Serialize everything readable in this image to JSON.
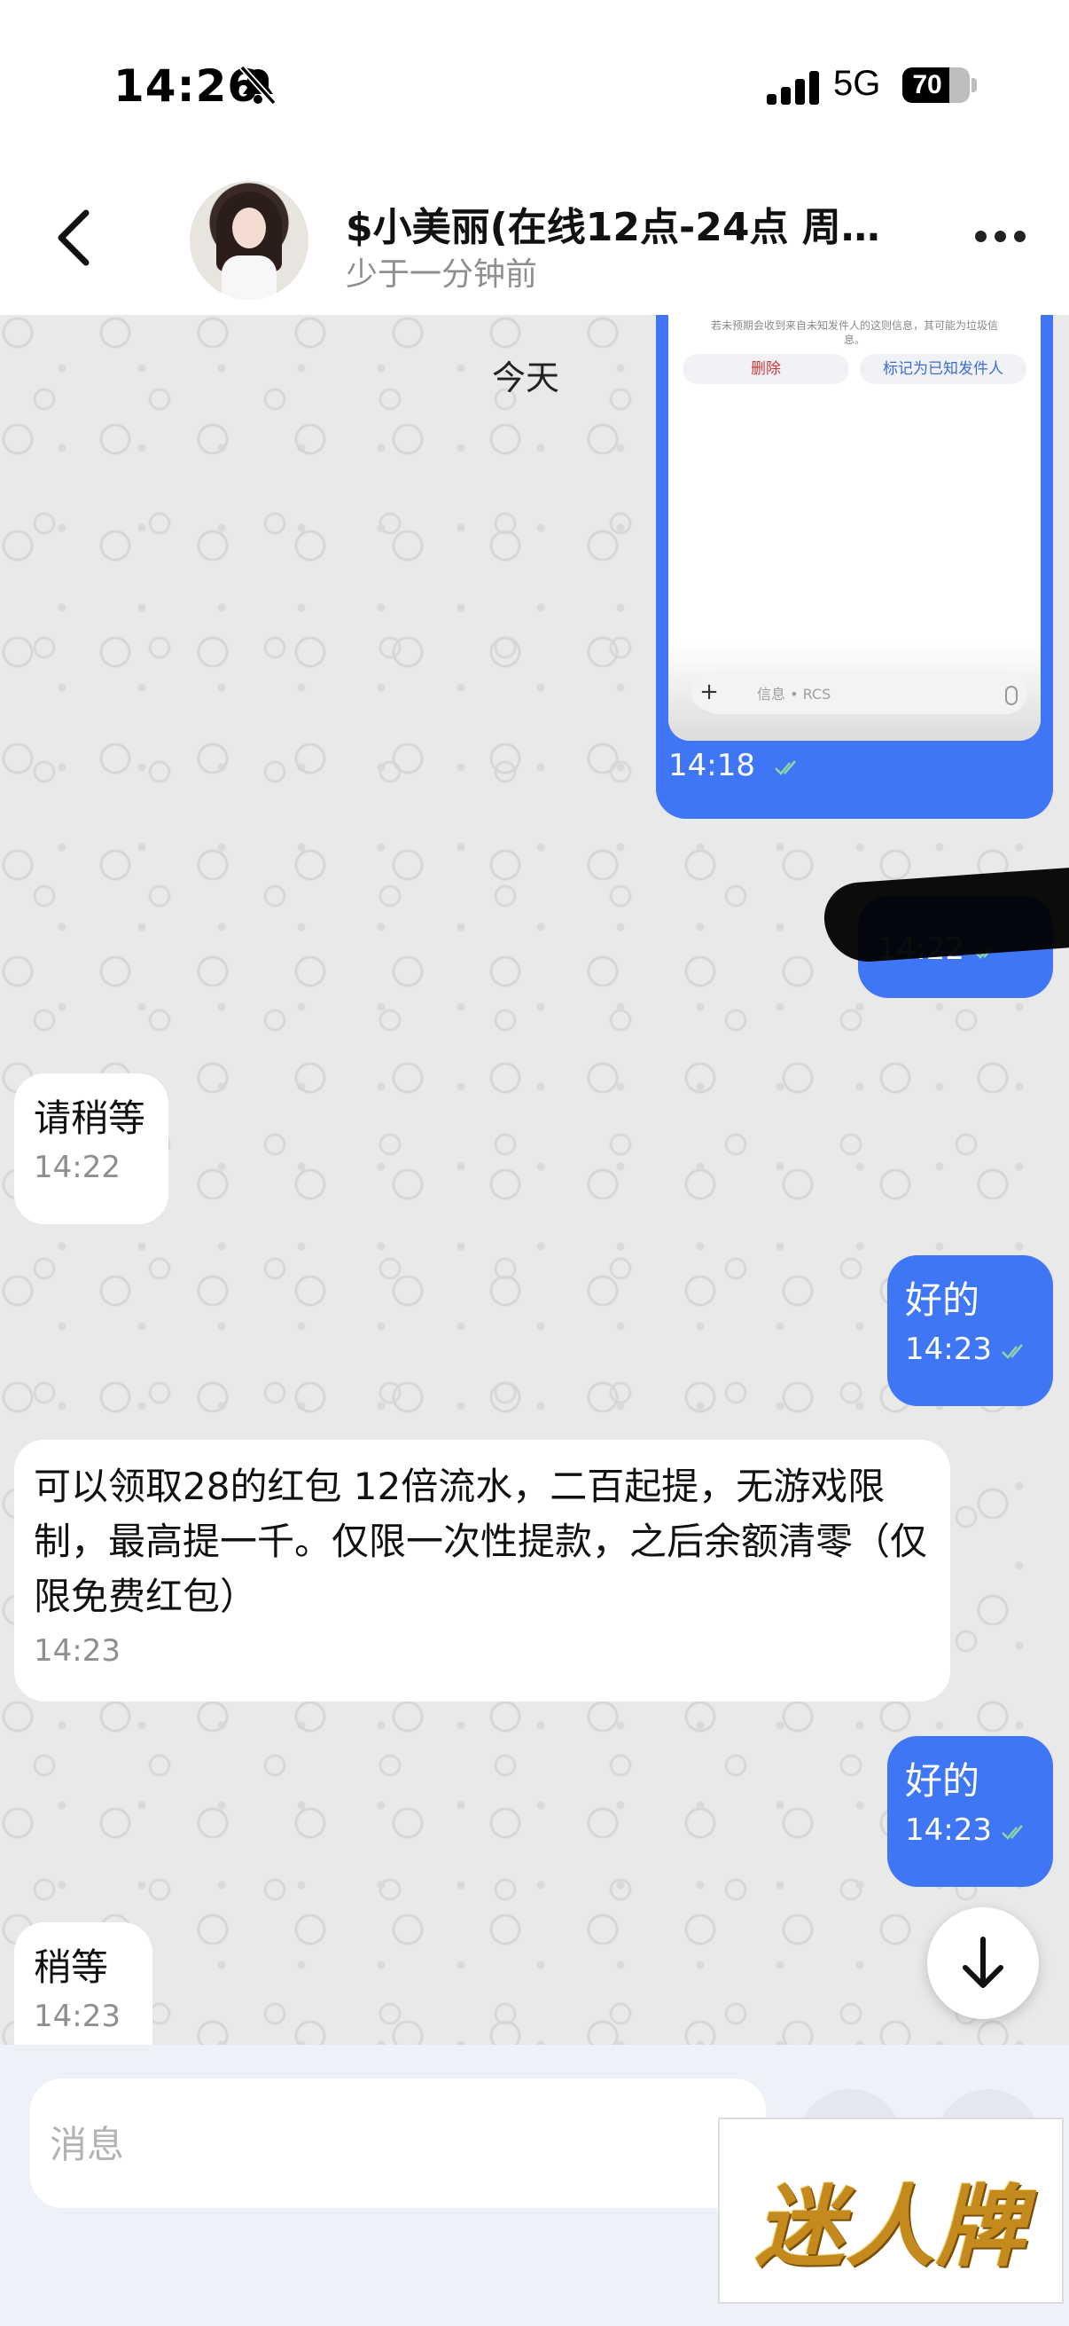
{
  "status_bar": {
    "time": "14:26",
    "network": "5G",
    "battery": "70",
    "battery_level": 0.7
  },
  "header": {
    "title": "$小美丽(在线12点-24点 周…",
    "subtitle": "少于一分钟前"
  },
  "chat": {
    "date_chip": "今天",
    "screenshot": {
      "hint_text": "若未预期会收到来自未知发件人的这则信息，其可能为垃圾信息。",
      "delete_label": "删除",
      "mark_label": "标记为已知发件人",
      "input_placeholder": "信息 • RCS",
      "plus_label": "+",
      "time": "14:18"
    },
    "messages": [
      {
        "direction": "out",
        "text": "",
        "time": "14:22"
      },
      {
        "direction": "in",
        "text": "请稍等",
        "time": "14:22"
      },
      {
        "direction": "out",
        "text": "好的",
        "time": "14:23"
      },
      {
        "direction": "in",
        "text": "可以领取28的红包 12倍流水，二百起提，无游戏限制，最高提一千。仅限一次性提款，之后余额清零（仅限免费红包）",
        "time": "14:23"
      },
      {
        "direction": "out",
        "text": "好的",
        "time": "14:23"
      },
      {
        "direction": "in",
        "text": "稍等",
        "time": "14:23"
      }
    ]
  },
  "composer": {
    "placeholder": "消息"
  },
  "watermark": {
    "text": "迷人牌"
  },
  "colors": {
    "outgoing_bubble": "#3f76f5",
    "incoming_bubble": "#ffffff",
    "composer_bg": "#eef1f8"
  },
  "icons": [
    "bell-slash-icon",
    "signal-icon",
    "battery-icon",
    "back-arrow-icon",
    "more-dots-icon",
    "double-check-icon",
    "arrow-down-icon",
    "microphone-icon"
  ]
}
